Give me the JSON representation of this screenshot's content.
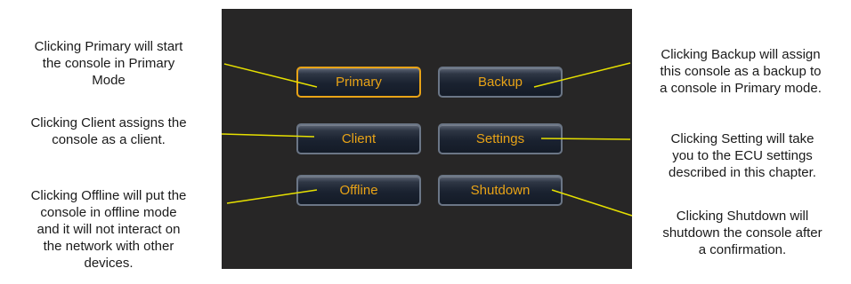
{
  "buttons": {
    "primary": "Primary",
    "backup": "Backup",
    "client": "Client",
    "settings": "Settings",
    "offline": "Offline",
    "shutdown": "Shutdown"
  },
  "annotations": {
    "primary": "Clicking Primary will start\nthe console in Primary\nMode",
    "client": "Clicking Client assigns the\nconsole as a client.",
    "offline": "Clicking Offline will put the\nconsole in offline mode\nand it will not interact on\nthe network with other\ndevices.",
    "backup": "Clicking Backup will assign\nthis console as a backup to\na console in Primary mode.",
    "settings": "Clicking Setting will take\nyou to the ECU settings\ndescribed in this chapter.",
    "shutdown": "Clicking Shutdown will\nshutdown the console after\na confirmation."
  },
  "colors": {
    "panel": "#272626",
    "button_text": "#e8a317",
    "selected_border": "#e8a317",
    "leader_line": "#e6e000"
  }
}
